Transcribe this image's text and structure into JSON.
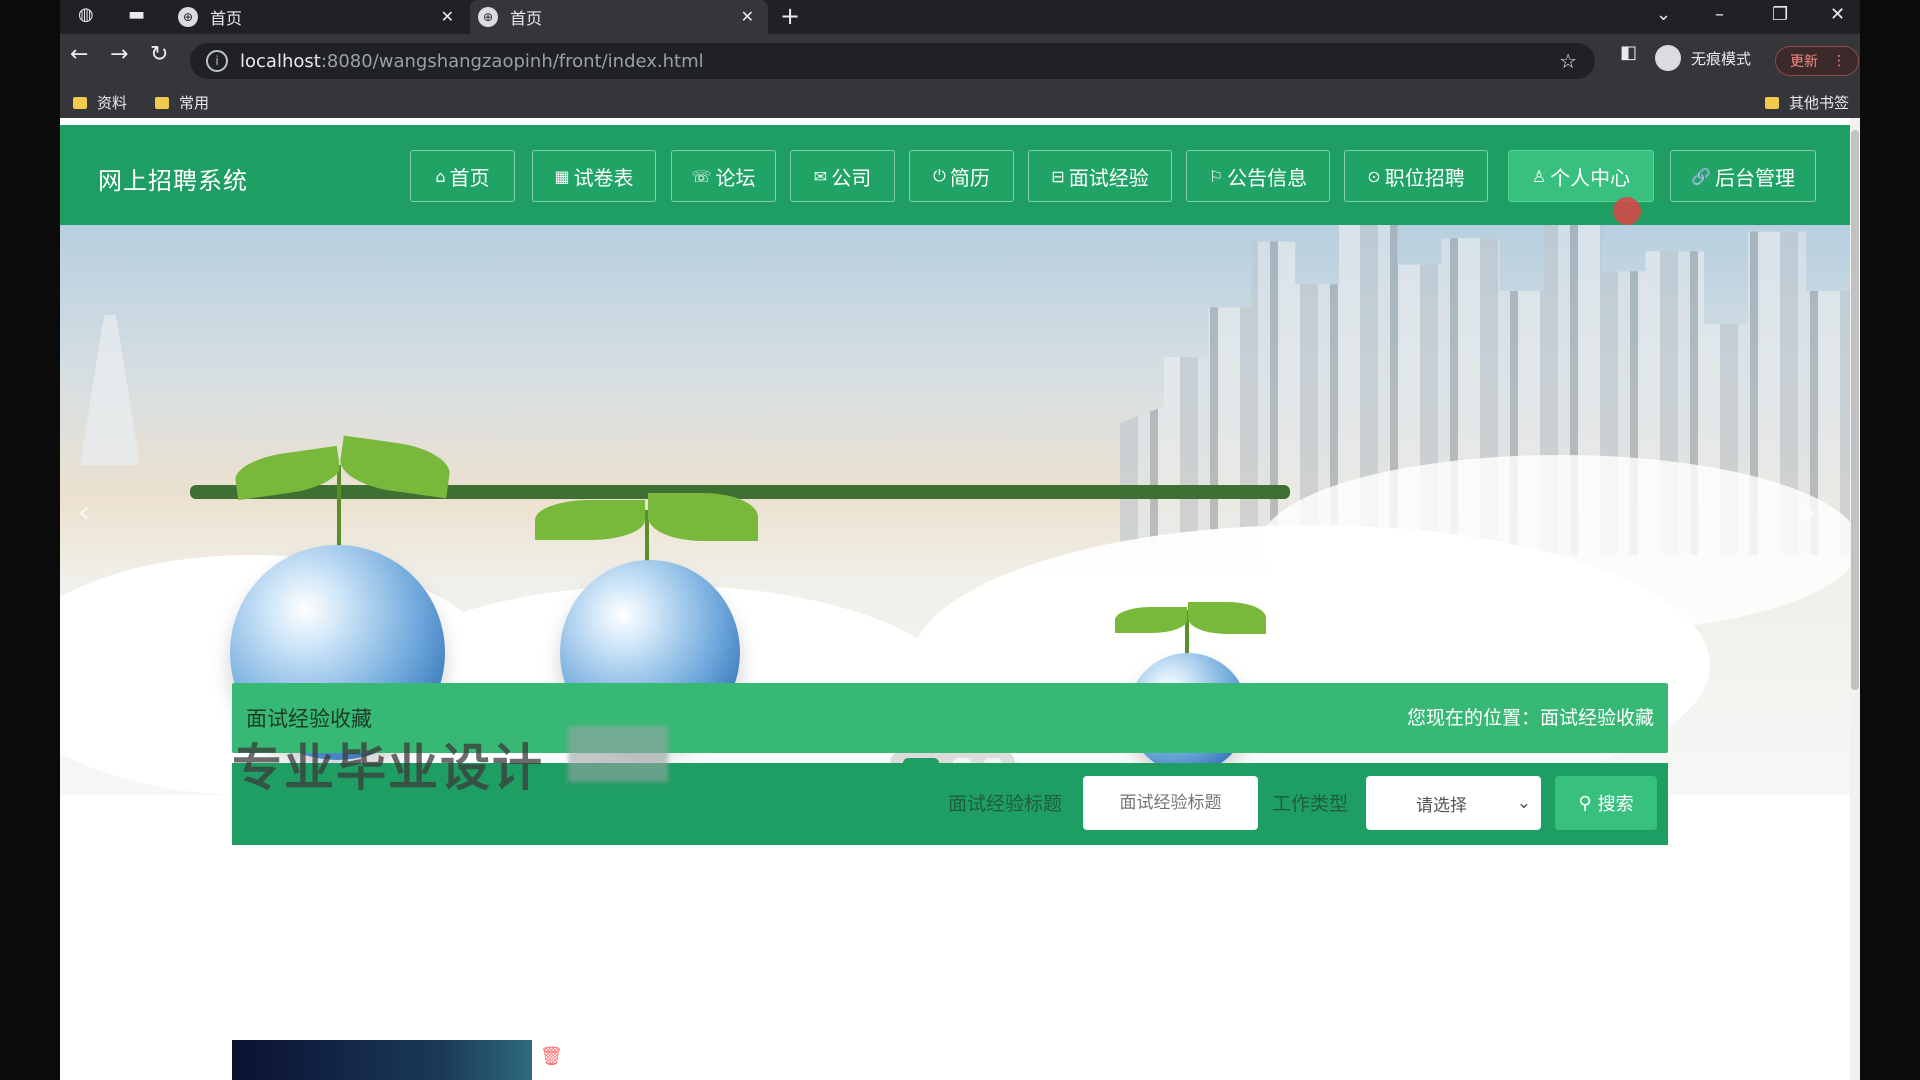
{
  "browser": {
    "tabs": [
      {
        "label": "首页"
      },
      {
        "label": "首页"
      }
    ],
    "url_host": "localhost",
    "url_rest": ":8080/wangshangzaopinh/front/index.html",
    "incognito_label": "无痕模式",
    "update_label": "更新",
    "bookmarks": [
      "资料",
      "常用"
    ],
    "other_bookmarks": "其他书签"
  },
  "site": {
    "brand": "网上招聘系统",
    "nav": [
      {
        "icon": "⌂",
        "label": "首页"
      },
      {
        "icon": "▦",
        "label": "试卷表"
      },
      {
        "icon": "☏",
        "label": "论坛"
      },
      {
        "icon": "✉",
        "label": "公司"
      },
      {
        "icon": "⏻",
        "label": "简历"
      },
      {
        "icon": "⊟",
        "label": "面试经验"
      },
      {
        "icon": "⚐",
        "label": "公告信息"
      },
      {
        "icon": "⊙",
        "label": "职位招聘"
      },
      {
        "icon": "♙",
        "label": "个人中心"
      },
      {
        "icon": "🔗",
        "label": "后台管理"
      }
    ]
  },
  "banner": {
    "slides": 3,
    "active_slide": 1
  },
  "crumb": {
    "title": "面试经验收藏",
    "location_label": "您现在的位置：",
    "location_value": "面试经验收藏"
  },
  "watermark": "专业毕业设计",
  "search": {
    "title_label": "面试经验标题",
    "title_placeholder": "面试经验标题",
    "type_label": "工作类型",
    "type_selected": "请选择",
    "button_label": "搜索"
  },
  "colors": {
    "primary": "#1f9e63",
    "accent": "#38c07f"
  }
}
